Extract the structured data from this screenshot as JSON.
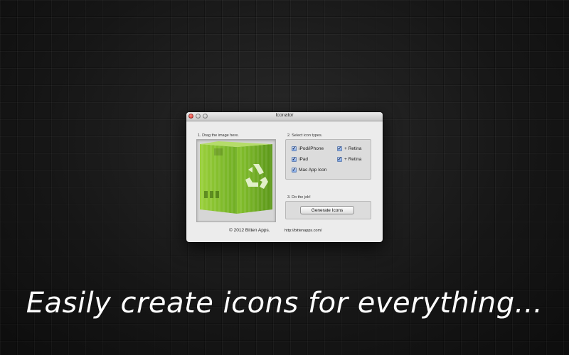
{
  "window": {
    "title": "Iconator"
  },
  "drop_section": {
    "label": "1. Drag the image here."
  },
  "icon_types_section": {
    "label": "2. Select icon types.",
    "options": [
      {
        "label": "iPod/iPhone",
        "checked": true
      },
      {
        "label": "+ Retina",
        "checked": true
      },
      {
        "label": "iPad",
        "checked": true
      },
      {
        "label": "+ Retina",
        "checked": true
      },
      {
        "label": "Mac App Icon",
        "checked": true
      }
    ],
    "check_glyph": "✓"
  },
  "action_section": {
    "label": "3. Do the job!",
    "button_label": "Generate Icons"
  },
  "footer": {
    "copyright": "© 2012 Bitten Apps.",
    "url": "http://bittenapps.com/"
  },
  "headline": "Easily create icons for everything...",
  "colors": {
    "box_green": "#7fbf2a",
    "box_green_dark": "#4f8c12",
    "close_red": "#d9332a"
  },
  "icons": {
    "window_close": "close-icon",
    "dropped_image": "recycle-box-icon"
  }
}
